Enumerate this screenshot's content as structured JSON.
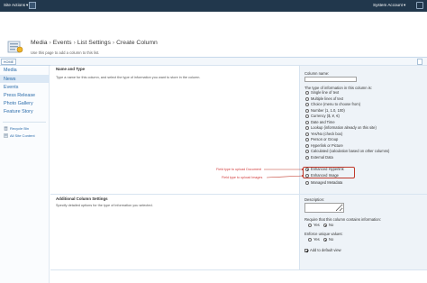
{
  "topbar": {
    "site_actions": "Site Actions",
    "site_actions_caret": "▾",
    "user": "System Account",
    "user_caret": "▾"
  },
  "header": {
    "breadcrumb": [
      "Media",
      "Events",
      "List Settings",
      "Create Column"
    ],
    "separator": "›",
    "description": "Use this page to add a column to this list."
  },
  "topnav": {
    "home": "HOME"
  },
  "quicklaunch": {
    "items": [
      "Media",
      "News",
      "Events",
      "Press Release",
      "Photo Gallery",
      "Feature Story"
    ],
    "recycle_bin": "Recycle Bin",
    "all_site_content": "All Site Content"
  },
  "name_type": {
    "title": "Name and Type",
    "description": "Type a name for this column, and select the type of information you want to store in the column.",
    "column_name_label": "Column name:",
    "column_name_value": "",
    "type_label": "The type of information in this column is:",
    "types": [
      {
        "label": "Single line of text",
        "checked": false
      },
      {
        "label": "Multiple lines of text",
        "checked": false
      },
      {
        "label": "Choice (menu to choose from)",
        "checked": false
      },
      {
        "label": "Number (1, 1.0, 100)",
        "checked": false
      },
      {
        "label": "Currency ($, ¥, €)",
        "checked": false
      },
      {
        "label": "Date and Time",
        "checked": false
      },
      {
        "label": "Lookup (information already on this site)",
        "checked": false
      },
      {
        "label": "Yes/No (check box)",
        "checked": false
      },
      {
        "label": "Person or Group",
        "checked": false
      },
      {
        "label": "Hyperlink or Picture",
        "checked": false
      },
      {
        "label": "Calculated (calculation based on other columns)",
        "checked": false
      },
      {
        "label": "External Data",
        "checked": false
      },
      {
        "label": "Enhanced Hyperlink",
        "checked": true
      },
      {
        "label": "Enhanced Image",
        "checked": false
      },
      {
        "label": "Managed Metadata",
        "checked": false
      }
    ]
  },
  "annotations": {
    "hyperlink": "Field type to upload Document",
    "image": "Field type to upload Images",
    "color": "#c0392b"
  },
  "additional": {
    "title": "Additional Column Settings",
    "description": "Specify detailed options for the type of information you selected.",
    "description_label": "Description:",
    "description_value": "",
    "require_label": "Require that this column contains information:",
    "enforce_label": "Enforce unique values:",
    "yes": "Yes",
    "no": "No",
    "require_value": "No",
    "enforce_value": "No",
    "add_default_view": "Add to default view",
    "add_default_view_checked": true
  }
}
